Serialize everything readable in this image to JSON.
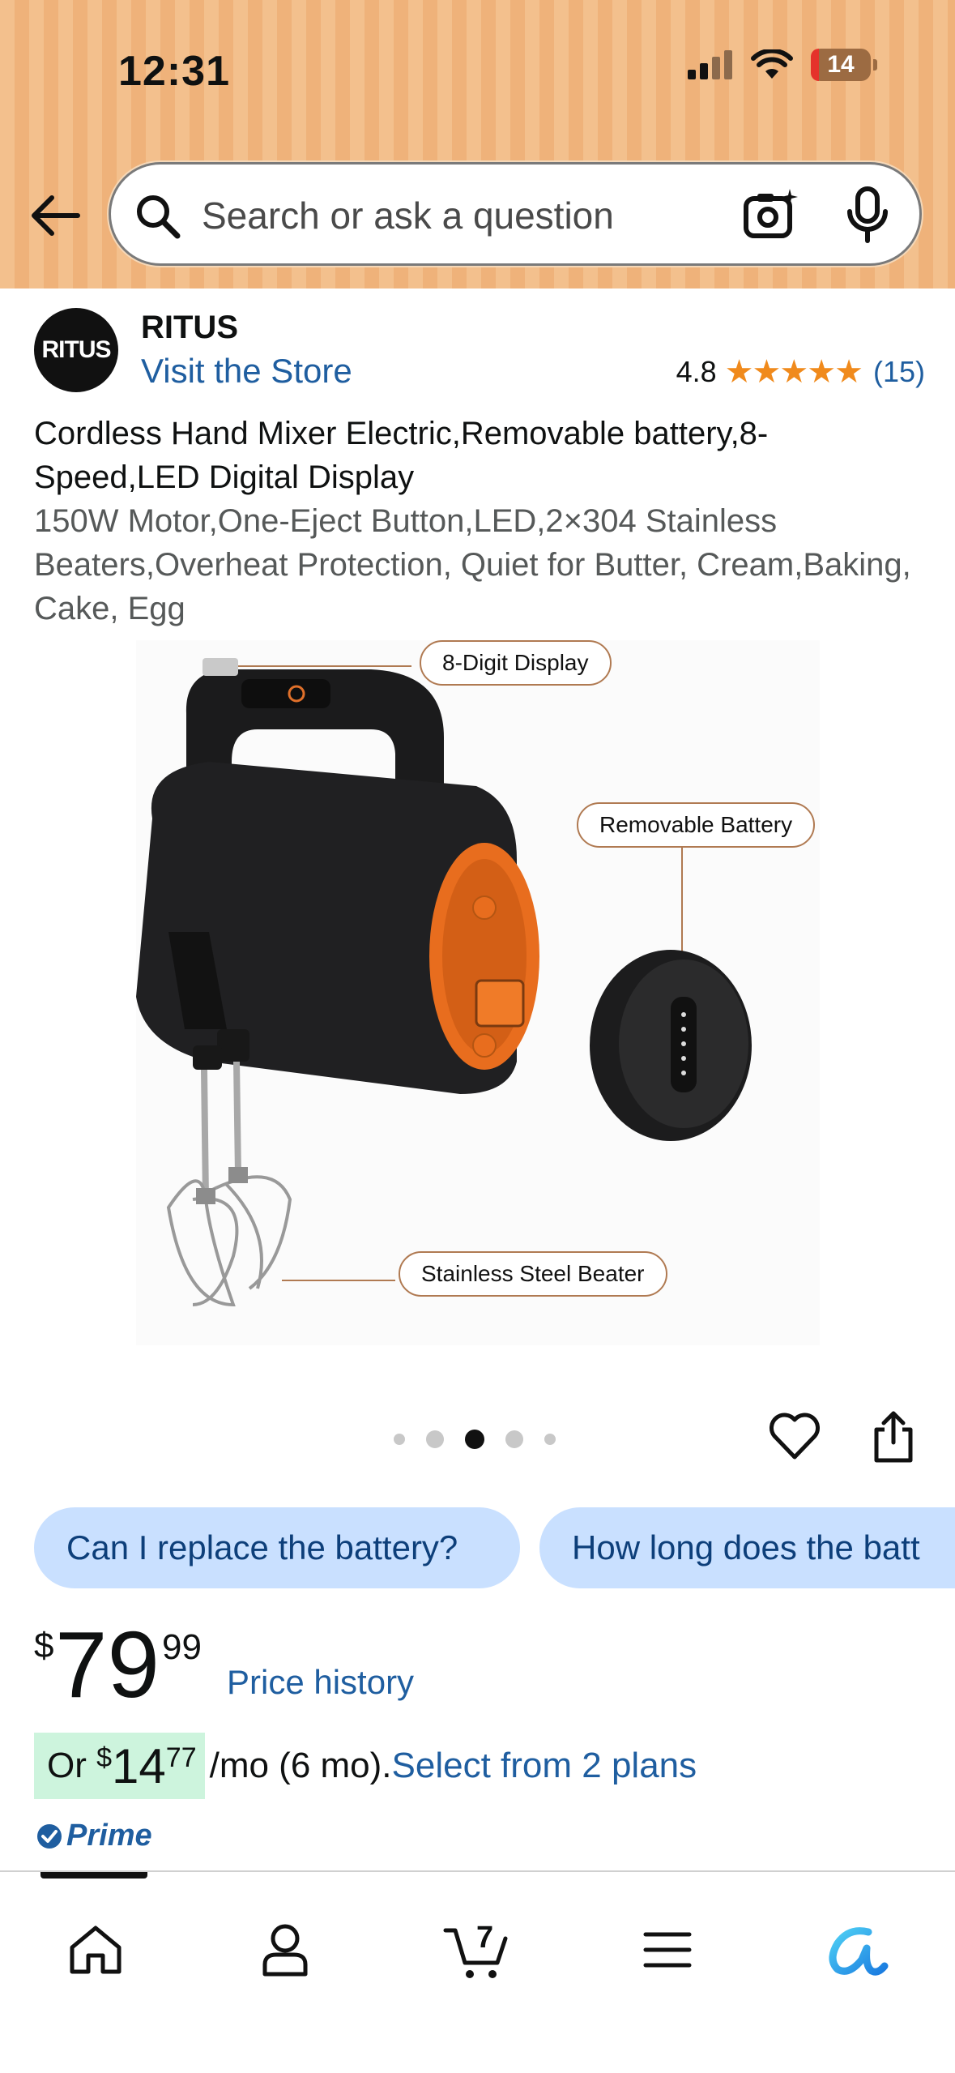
{
  "status_bar": {
    "time": "12:31",
    "battery": "14"
  },
  "search": {
    "placeholder": "Search or ask a question"
  },
  "brand": {
    "logo_text": "RITUS",
    "name": "RITUS",
    "visit_store": "Visit the Store"
  },
  "rating": {
    "value": "4.8",
    "stars": "★★★★★",
    "count": "(15)"
  },
  "product": {
    "title": "Cordless Hand Mixer Electric,Removable battery,8-Speed,LED Digital Display",
    "subtitle": "150W Motor,One-Eject Button,LED,2×304 Stainless Beaters,Overheat Protection, Quiet for Butter, Cream,Baking, Cake, Egg"
  },
  "image_callouts": {
    "display": "8-Digit Display",
    "battery": "Removable Battery",
    "beater": "Stainless Steel Beater"
  },
  "carousel": {
    "count": 5,
    "active_index": 2
  },
  "suggestions": [
    "Can I replace the battery?",
    "How long does the batt"
  ],
  "price": {
    "symbol": "$",
    "whole": "79",
    "fraction": "99",
    "history_link": "Price history"
  },
  "installment": {
    "prefix": "Or ",
    "symbol": "$",
    "whole": "14",
    "fraction": "77",
    "suffix": "/mo (6 mo).",
    "link": "Select from 2 plans"
  },
  "prime": {
    "label": "Prime"
  },
  "tabbar": {
    "items": [
      "home-icon",
      "account-icon",
      "cart-icon",
      "menu-icon",
      "rufus-icon"
    ],
    "cart_count": "7"
  },
  "colors": {
    "accent_link": "#1f5ea0",
    "star": "#f08a1c",
    "header": "#f3c08d",
    "pill_bg": "#c9e0ff",
    "installment_bg": "#cdf4dd"
  }
}
